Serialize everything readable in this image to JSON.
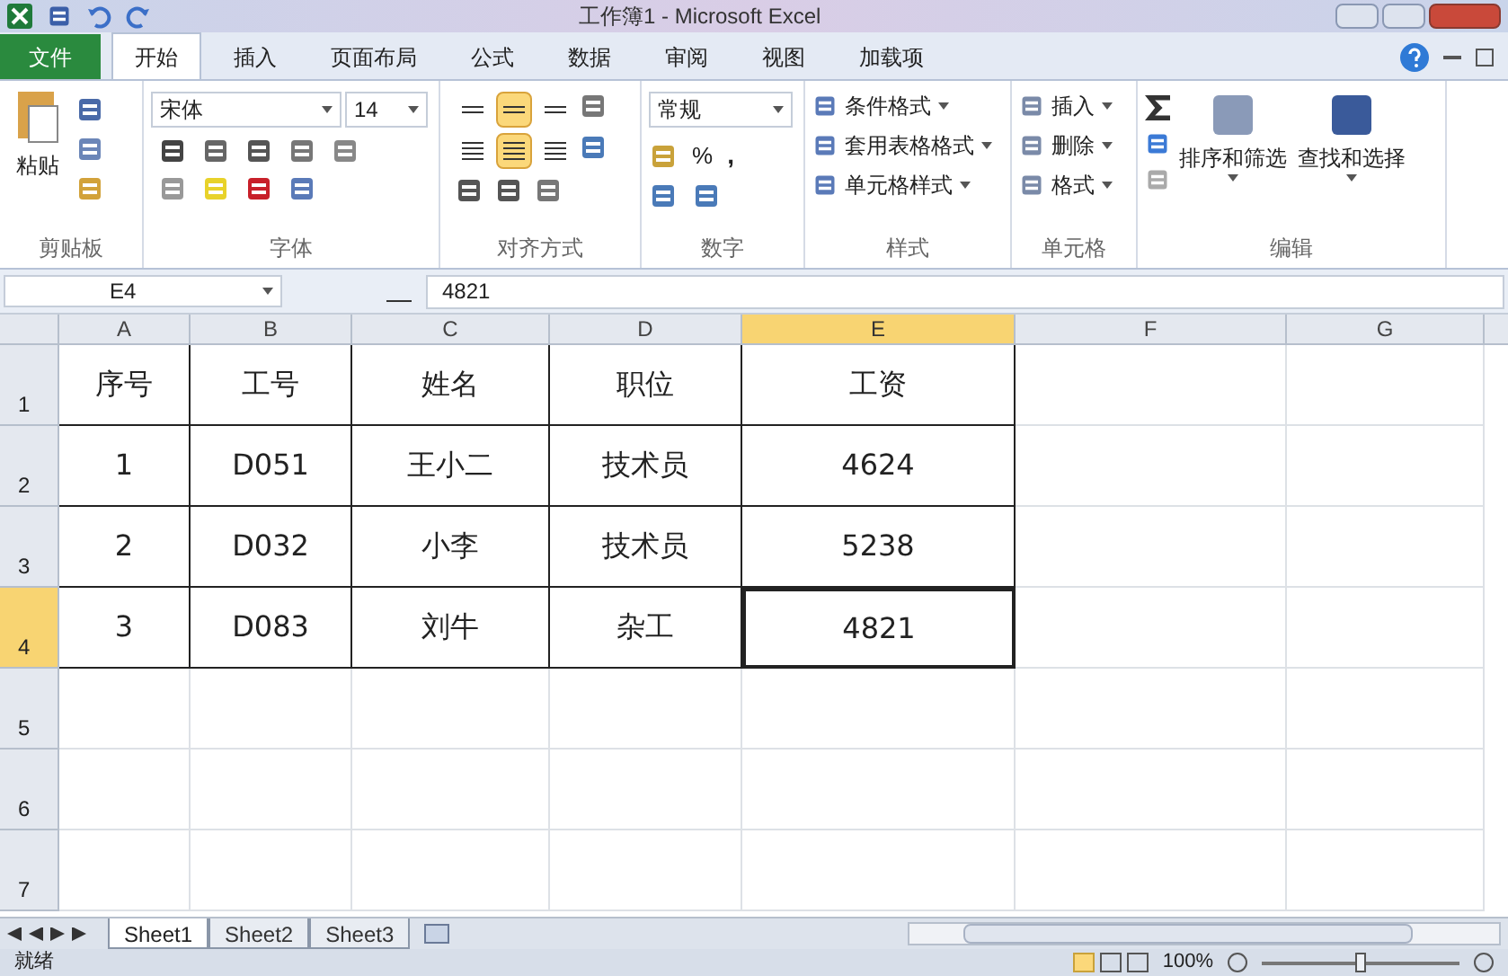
{
  "title_bar": {
    "title": "工作簿1 - Microsoft Excel"
  },
  "ribbon_tabs": [
    {
      "label": "文件",
      "kind": "file",
      "selected": false
    },
    {
      "label": "开始",
      "kind": "tab",
      "selected": true
    },
    {
      "label": "插入",
      "kind": "tab",
      "selected": false
    },
    {
      "label": "页面布局",
      "kind": "tab",
      "selected": false
    },
    {
      "label": "公式",
      "kind": "tab",
      "selected": false
    },
    {
      "label": "数据",
      "kind": "tab",
      "selected": false
    },
    {
      "label": "审阅",
      "kind": "tab",
      "selected": false
    },
    {
      "label": "视图",
      "kind": "tab",
      "selected": false
    },
    {
      "label": "加载项",
      "kind": "tab",
      "selected": false
    }
  ],
  "clipboard": {
    "label": "剪贴板",
    "paste": "粘贴"
  },
  "font": {
    "label": "字体",
    "font_name": "宋体",
    "font_size": "14"
  },
  "alignment": {
    "label": "对齐方式",
    "vertical": [
      {
        "selected": false
      },
      {
        "selected": true
      },
      {
        "selected": false
      }
    ],
    "horizontal": [
      {
        "selected": false
      },
      {
        "selected": true
      },
      {
        "selected": false
      }
    ]
  },
  "number": {
    "label": "数字",
    "format": "常规",
    "percent": "%",
    "comma": ","
  },
  "styles": {
    "label": "样式",
    "items": [
      "条件格式",
      "套用表格格式",
      "单元格样式"
    ]
  },
  "cells_group": {
    "label": "单元格",
    "items": [
      "插入",
      "删除",
      "格式"
    ]
  },
  "editing": {
    "label": "编辑",
    "items": [
      "排序和筛选",
      "查找和选择"
    ]
  },
  "formula_bar": {
    "name_box": "E4",
    "value": "4821"
  },
  "sheet": {
    "columns": [
      {
        "label": "A",
        "selected": false
      },
      {
        "label": "B",
        "selected": false
      },
      {
        "label": "C",
        "selected": false
      },
      {
        "label": "D",
        "selected": false
      },
      {
        "label": "E",
        "selected": true
      },
      {
        "label": "F",
        "selected": false
      },
      {
        "label": "G",
        "selected": false
      }
    ],
    "rows": [
      {
        "label": "1",
        "selected": false,
        "cells": [
          "序号",
          "工号",
          "姓名",
          "职位",
          "工资"
        ]
      },
      {
        "label": "2",
        "selected": false,
        "cells": [
          "1",
          "D051",
          "王小二",
          "技术员",
          "4624"
        ]
      },
      {
        "label": "3",
        "selected": false,
        "cells": [
          "2",
          "D032",
          "小李",
          "技术员",
          "5238"
        ]
      },
      {
        "label": "4",
        "selected": true,
        "cells": [
          "3",
          "D083",
          "刘牛",
          "杂工",
          "4821"
        ]
      },
      {
        "label": "5",
        "selected": false,
        "cells": []
      },
      {
        "label": "6",
        "selected": false,
        "cells": []
      },
      {
        "label": "7",
        "selected": false,
        "cells": []
      }
    ]
  },
  "sheet_tabs": [
    {
      "label": "Sheet1",
      "selected": true
    },
    {
      "label": "Sheet2",
      "selected": false
    },
    {
      "label": "Sheet3",
      "selected": false
    }
  ],
  "status_bar": {
    "status": "就绪",
    "zoom": "100%",
    "level": 0.5
  }
}
